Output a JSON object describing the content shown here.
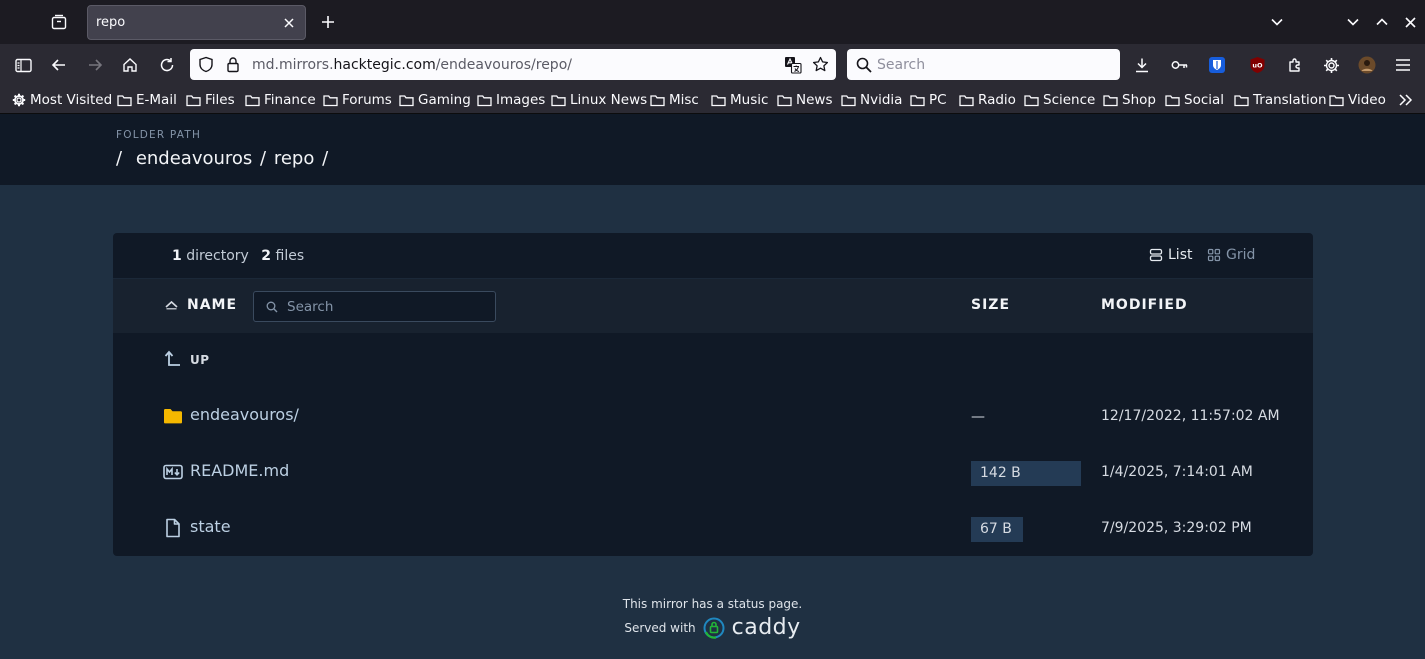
{
  "browser": {
    "tab_title": "repo",
    "url_prefix": "md.mirrors.",
    "url_domain": "hacktegic.com",
    "url_path": "/endeavouros/repo/",
    "search_placeholder": "Search",
    "bookmarks": [
      "Most Visited",
      "E-Mail",
      "Files",
      "Finance",
      "Forums",
      "Gaming",
      "Images",
      "Linux News",
      "Misc",
      "Music",
      "News",
      "Nvidia",
      "PC",
      "Radio",
      "Science",
      "Shop",
      "Social",
      "Translation",
      "Video"
    ]
  },
  "header": {
    "label": "FOLDER PATH",
    "crumbs": [
      "/",
      "endeavouros",
      "/",
      "repo",
      "/"
    ]
  },
  "listing": {
    "dir_count": "1",
    "dir_word": "directory",
    "file_count": "2",
    "file_word": "files",
    "list_label": "List",
    "grid_label": "Grid",
    "col_name": "NAME",
    "col_size": "SIZE",
    "col_modified": "MODIFIED",
    "filter_placeholder": "Search",
    "up_label": "UP",
    "rows": [
      {
        "name": "endeavouros/",
        "size": "—",
        "modified": "12/17/2022, 11:57:02 AM",
        "type": "folder"
      },
      {
        "name": "README.md",
        "size": "142 B",
        "modified": "1/4/2025, 7:14:01 AM",
        "type": "markdown",
        "size_fraction": 1.0
      },
      {
        "name": "state",
        "size": "67 B",
        "modified": "7/9/2025, 3:29:02 PM",
        "type": "file",
        "size_fraction": 0.47
      }
    ]
  },
  "footer": {
    "status_text": "This mirror has a status page.",
    "served_with": "Served with",
    "caddy": "caddy"
  },
  "colors": {
    "page_bg": "#1f3042",
    "panel_bg": "#101926",
    "folder_yellow": "#f5b800",
    "size_bar": "#243b55"
  }
}
